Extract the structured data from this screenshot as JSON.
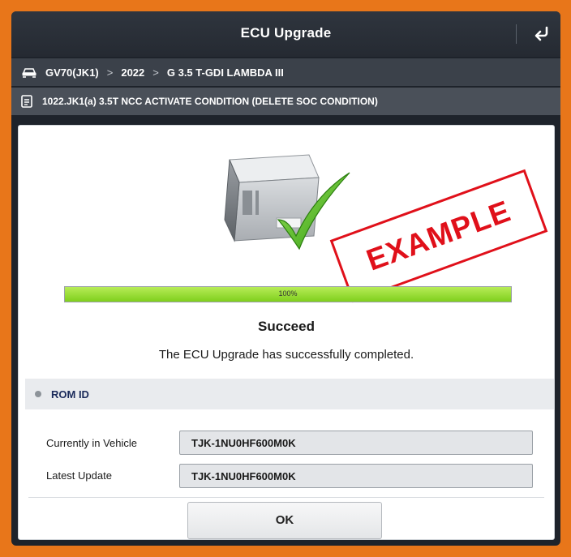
{
  "window": {
    "title": "ECU Upgrade"
  },
  "breadcrumb": {
    "vehicle": "GV70(JK1)",
    "year": "2022",
    "engine": "G 3.5 T-GDI LAMBDA III",
    "separator": ">"
  },
  "procedure": {
    "title": "1022.JK1(a) 3.5T NCC ACTIVATE CONDITION (DELETE SOC CONDITION)"
  },
  "watermark": "EXAMPLE",
  "progress": {
    "value": 1.0,
    "label": "100%"
  },
  "result": {
    "status": "Succeed",
    "message": "The ECU Upgrade has successfully completed."
  },
  "rom": {
    "header": "ROM ID",
    "rows": [
      {
        "label": "Currently in Vehicle",
        "value": "TJK-1NU0HF600M0K"
      },
      {
        "label": "Latest Update",
        "value": "TJK-1NU0HF600M0K"
      }
    ]
  },
  "actions": {
    "ok_label": "OK"
  },
  "colors": {
    "frame": "#e8761a",
    "progress": "#8fd82a",
    "stamp": "#e0101a",
    "check": "#3aa815"
  },
  "icons": {
    "back": "return-arrow-icon",
    "vehicle": "car-icon",
    "procedure": "document-icon",
    "hero": "ecu-module-check-icon"
  }
}
